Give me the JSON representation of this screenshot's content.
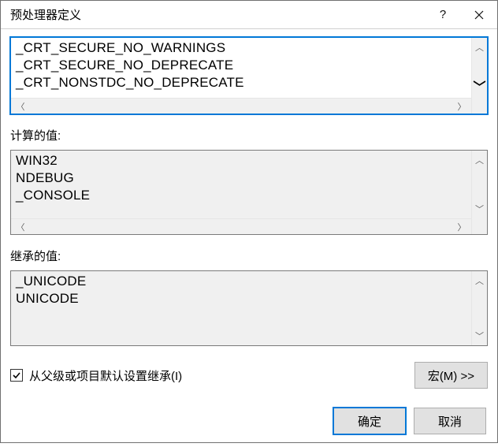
{
  "window": {
    "title": "预处理器定义"
  },
  "editable": {
    "items": [
      "_CRT_SECURE_NO_WARNINGS",
      "_CRT_SECURE_NO_DEPRECATE",
      "_CRT_NONSTDC_NO_DEPRECATE"
    ]
  },
  "computed": {
    "label": "计算的值:",
    "items": [
      "WIN32",
      "NDEBUG",
      "_CONSOLE"
    ]
  },
  "inherited": {
    "label": "继承的值:",
    "items": [
      "_UNICODE",
      "UNICODE"
    ]
  },
  "inherit_checkbox": {
    "checked": true,
    "label": "从父级或项目默认设置继承(I)"
  },
  "buttons": {
    "macros": "宏(M) >>",
    "ok": "确定",
    "cancel": "取消"
  }
}
